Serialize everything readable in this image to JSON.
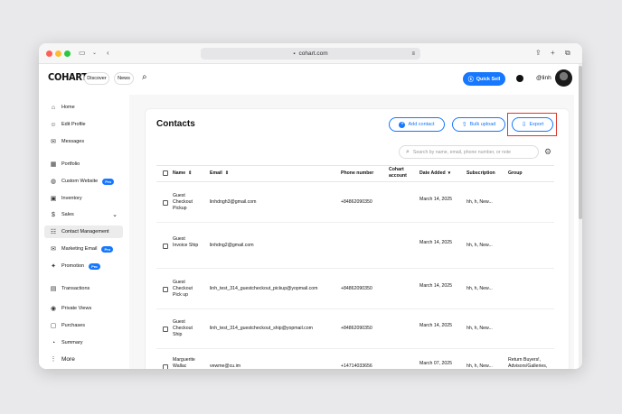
{
  "browser": {
    "url": "cohart.com"
  },
  "header": {
    "logo": "COHART",
    "discover": "Discover",
    "news": "News",
    "quick_sell": "Quick Sell",
    "username": "@linh"
  },
  "sidebar": {
    "items": [
      {
        "label": "Home",
        "icon": "home-icon",
        "glyph": "⌂"
      },
      {
        "label": "Edit Profile",
        "icon": "user-icon",
        "glyph": "☺"
      },
      {
        "label": "Messages",
        "icon": "message-icon",
        "glyph": "✉"
      },
      {
        "label": "Portfolio",
        "icon": "portfolio-icon",
        "glyph": "▦"
      },
      {
        "label": "Custom Website",
        "icon": "globe-icon",
        "glyph": "◍",
        "badge": "Pro"
      },
      {
        "label": "Inventory",
        "icon": "image-icon",
        "glyph": "▣"
      },
      {
        "label": "Sales",
        "icon": "dollar-icon",
        "glyph": "$"
      },
      {
        "label": "Contact Management",
        "icon": "contacts-icon",
        "glyph": "☷"
      },
      {
        "label": "Marketing Email",
        "icon": "mail-icon",
        "glyph": "✉",
        "badge": "Pro"
      },
      {
        "label": "Promotion",
        "icon": "gift-icon",
        "glyph": "✦",
        "badge": "Pro"
      },
      {
        "label": "Transactions",
        "icon": "receipt-icon",
        "glyph": "▤"
      },
      {
        "label": "Private Views",
        "icon": "eye-icon",
        "glyph": "◉"
      },
      {
        "label": "Purchases",
        "icon": "bag-icon",
        "glyph": "▢"
      },
      {
        "label": "Summary",
        "icon": "summary-icon",
        "glyph": "◔"
      },
      {
        "label": "More",
        "icon": "more-icon",
        "glyph": "⋮"
      }
    ]
  },
  "contacts": {
    "title": "Contacts",
    "add_contact": "Add contact",
    "bulk_upload": "Bulk upload",
    "export": "Export",
    "search_placeholder": "Search by name, email, phone number, or note",
    "columns": [
      "Name",
      "Email",
      "Phone number",
      "Cohart account",
      "Date Added",
      "Subscription",
      "Group"
    ],
    "rows": [
      {
        "name": "Guest Checkout Pickup",
        "email": "linhdngh3@gmail.com",
        "phone": "+84862090350",
        "cohart": "",
        "date": "March 14, 2025",
        "subscription": "hh, h, New...",
        "group": ""
      },
      {
        "name": "Guest Invoice Ship",
        "email": "linhdng2@gmail.com",
        "phone": "",
        "cohart": "",
        "date": "March 14, 2025",
        "subscription": "hh, h, New...",
        "group": ""
      },
      {
        "name": "Guest Checkout Pick up",
        "email": "linh_test_314_guestcheckout_pickup@yopmail.com",
        "phone": "+84862090350",
        "cohart": "",
        "date": "March 14, 2025",
        "subscription": "hh, h, New...",
        "group": ""
      },
      {
        "name": "Guest Checkout Ship",
        "email": "linh_test_314_guestcheckout_ship@yopmail.com",
        "phone": "+84862090350",
        "cohart": "",
        "date": "March 14, 2025",
        "subscription": "hh, h, New...",
        "group": ""
      },
      {
        "name": "Marguerite Wallac",
        "email": "vewme@cu.im",
        "phone": "+14714033656",
        "cohart": "",
        "date": "March 07, 2025",
        "subscription": "hh, h, New...",
        "group": "Return Buyers!, Advisors/Galleries, Friends/Colleagues"
      }
    ]
  }
}
